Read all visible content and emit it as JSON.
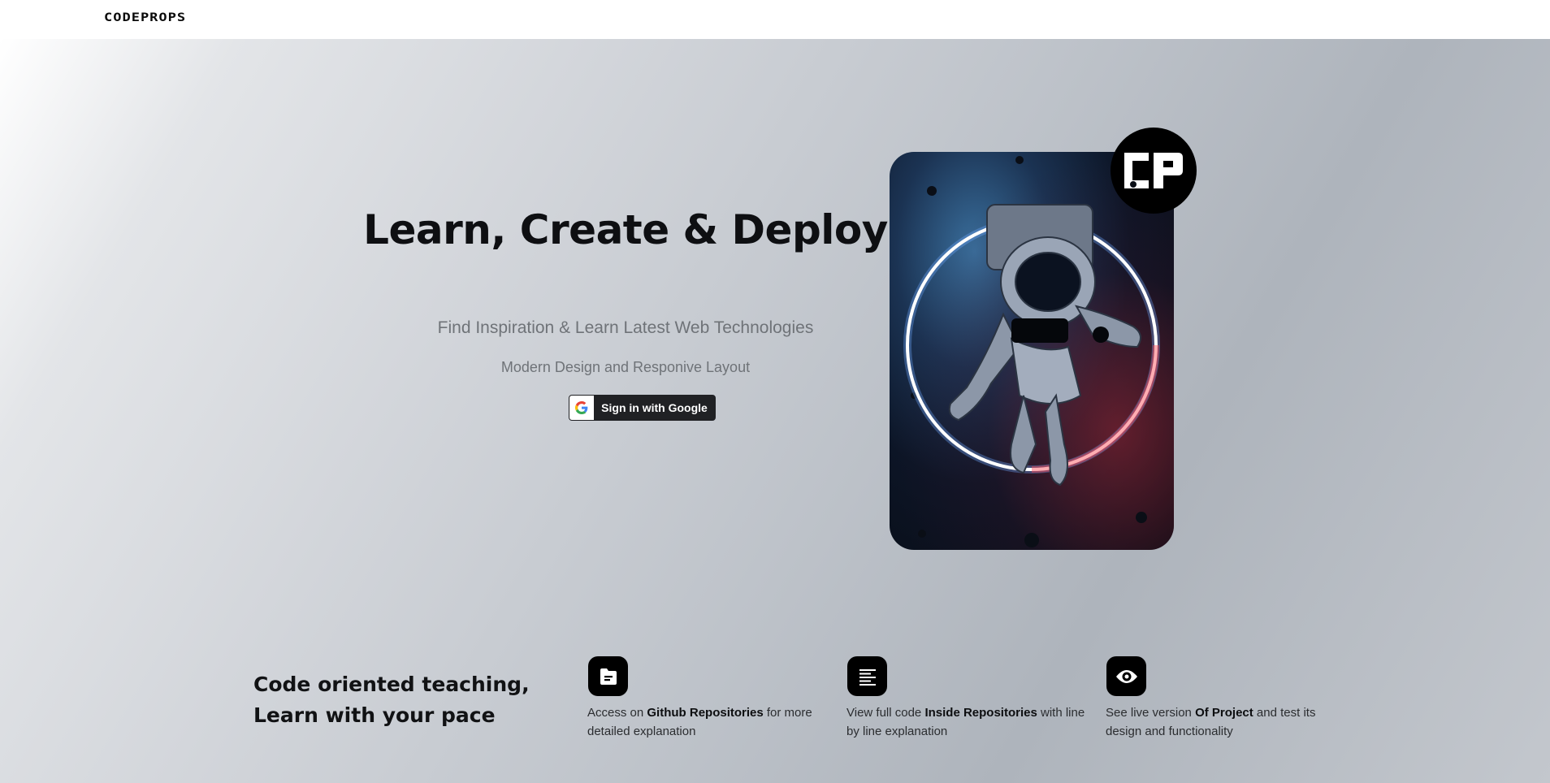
{
  "header": {
    "logo_text": "CODEPROPS"
  },
  "hero": {
    "title": "Learn, Create & Deploy",
    "subtitle": "Find Inspiration & Learn Latest Web Technologies",
    "subtitle2": "Modern Design and Responive Layout",
    "google_button": {
      "label": "Sign in with Google",
      "icon": "google-g-icon"
    },
    "badge_text": "CP",
    "image_icon": "astronaut-illustration"
  },
  "features": {
    "tagline_line1": "Code oriented teaching,",
    "tagline_line2": "Learn with your pace",
    "items": [
      {
        "icon": "folder-icon",
        "pre": "Access on ",
        "bold": "Github Repositories",
        "post": " for more detailed explanation"
      },
      {
        "icon": "text-lines-icon",
        "pre": "View full code ",
        "bold": "Inside Repositories",
        "post": " with line by line explanation"
      },
      {
        "icon": "eye-icon",
        "pre": "See live version ",
        "bold": "Of Project",
        "post": " and test its design and functionality"
      }
    ]
  },
  "colors": {
    "accent": "#000000",
    "button_bg": "#202124",
    "ring_blue": "#9fd2ff",
    "ring_red": "#ff4a55"
  }
}
